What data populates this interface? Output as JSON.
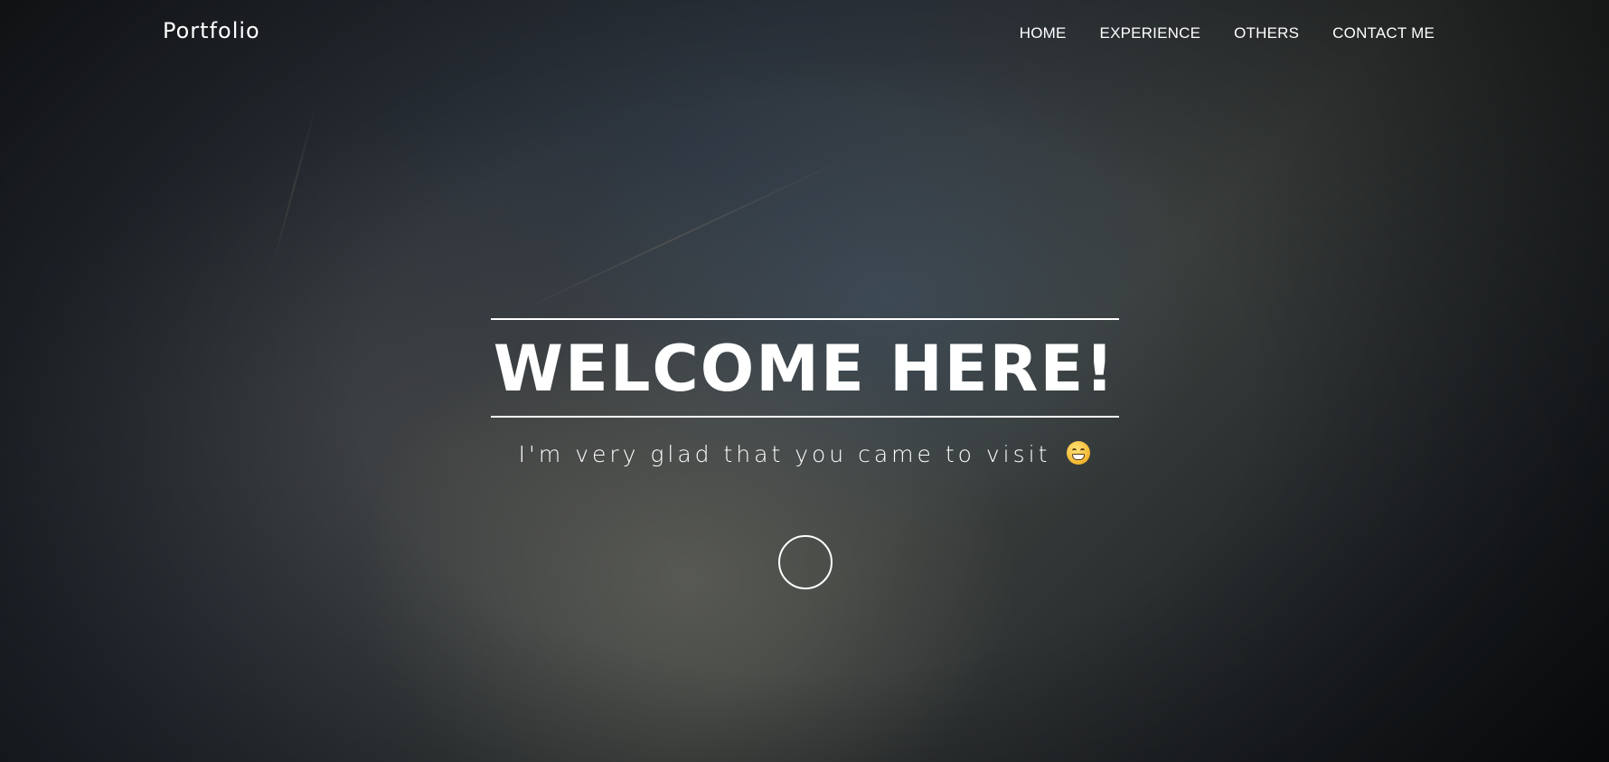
{
  "nav": {
    "brand": "Portfolio",
    "items": [
      {
        "label": "HOME"
      },
      {
        "label": "EXPERIENCE"
      },
      {
        "label": "OTHERS"
      },
      {
        "label": "CONTACT ME"
      }
    ]
  },
  "hero": {
    "title": "WELCOME HERE!",
    "subtitle": "I'm very glad that you came to visit",
    "emoji_icon": "grinning-face-icon",
    "scroll_icon": "scroll-down-circle-icon"
  },
  "colors": {
    "text": "#ffffff",
    "background_dark": "#1a1d21"
  }
}
